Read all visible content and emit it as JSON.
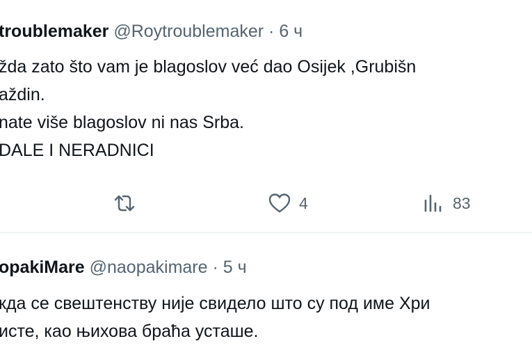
{
  "tweet1": {
    "display_name": "troublemaker",
    "handle": "@Roytroublemaker",
    "separator": "·",
    "time": "6 ч",
    "lines": [
      "žda zato što vam je blagoslov već dao Osijek ,Grubišn",
      "aždin.",
      "nate više blagoslov ni nas Srba.",
      "DALE I NERADNICI"
    ],
    "actions": {
      "retweet_icon": "retweet-icon",
      "like_icon": "heart-icon",
      "like_count": "4",
      "views_icon": "views-bar-chart-icon",
      "views_count": "83"
    }
  },
  "tweet2": {
    "display_name": "opakiMare",
    "handle": "@naopakimare",
    "separator": "·",
    "time": "5 ч",
    "lines": [
      "кда се свештенству није свидело што су под име Хри",
      "исте, као њихова браћа усташе."
    ]
  },
  "colors": {
    "text": "#0f1419",
    "muted": "#536471",
    "divider": "#eff3f4"
  }
}
